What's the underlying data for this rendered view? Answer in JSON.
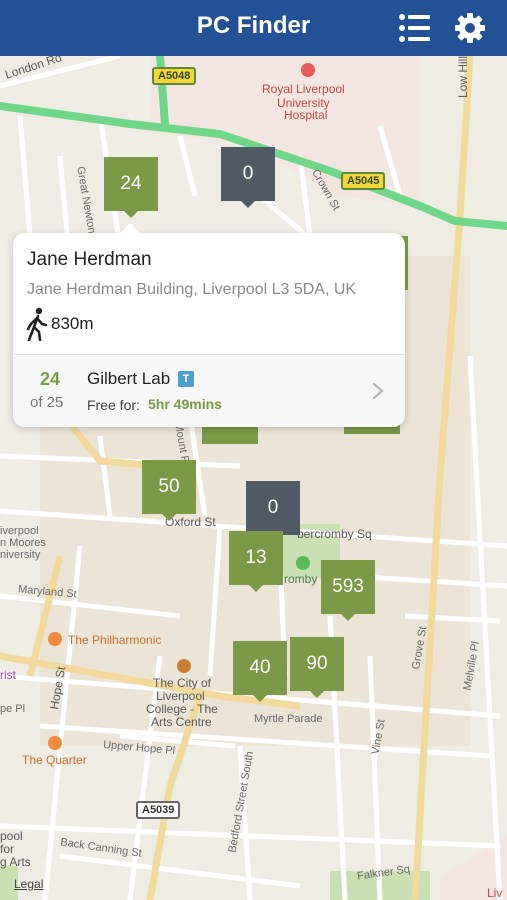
{
  "header": {
    "title": "PC Finder",
    "list_icon": "list-icon",
    "settings_icon": "gear-icon",
    "bg_color": "#235195"
  },
  "map": {
    "labels": {
      "london_rd": "London Rd",
      "a5048": "A5048",
      "hospital_1": "Royal Liverpool",
      "hospital_2": "University",
      "hospital_3": "Hospital",
      "low_hill": "Low Hill",
      "a5045": "A5045",
      "crown_st": "Crown St",
      "great_newton": "Great Newton",
      "mount_pl": "Mount Pl",
      "oxford_st": "Oxford St",
      "abercromby_sq": "bercromby Sq",
      "abercromby": "romby",
      "ljmu_1": "iverpool",
      "ljmu_2": "n Moores",
      "ljmu_3": "niversity",
      "maryland_st": "Maryland St",
      "philharmonic": "The Philharmonic",
      "hope_st": "Hope St",
      "grove_st": "Grove St",
      "melville_pl": "Melville Pl",
      "city_college_1": "The City of",
      "city_college_2": "Liverpool",
      "city_college_3": "College - The",
      "city_college_4": "Arts Centre",
      "myrtle_parade": "Myrtle Parade",
      "rist": "rist",
      "pe_pl": "pe Pl",
      "upper_hope_pl": "Upper Hope Pl",
      "the_quarter": "The Quarter",
      "vine_st": "Vine St",
      "a5039": "A5039",
      "bedford_st": "Bedford Street South",
      "lpool_1": "pool",
      "lpool_2": "for",
      "lpool_3": "g Arts",
      "back_canning": "Back Canning St",
      "faulkner_sq": "Falkner Sq",
      "legal": "Legal",
      "liv": "Liv"
    },
    "markers": [
      {
        "id": "m1",
        "label": "24",
        "status": "available"
      },
      {
        "id": "m2",
        "label": "0",
        "status": "full"
      },
      {
        "id": "m3",
        "label": "50",
        "status": "available"
      },
      {
        "id": "m4",
        "label": "0",
        "status": "full"
      },
      {
        "id": "m5",
        "label": "13",
        "status": "available"
      },
      {
        "id": "m6",
        "label": "593",
        "status": "available"
      },
      {
        "id": "m7",
        "label": "40",
        "status": "available"
      },
      {
        "id": "m8",
        "label": "90",
        "status": "available"
      }
    ],
    "colors": {
      "available": "#7a9a47",
      "full": "#4f5a66",
      "motorway": "#6fd68a",
      "major_road": "#f2d99c"
    }
  },
  "callout": {
    "name": "Jane Herdman",
    "address": "Jane Herdman Building, Liverpool L3 5DA, UK",
    "walk_icon": "walking-person-icon",
    "distance": "830m",
    "lab": {
      "available": "24",
      "total": "of 25",
      "name": "Gilbert Lab",
      "badge": "T",
      "free_label": "Free for:",
      "free_value": "5hr 49mins",
      "chevron_icon": "chevron-right-icon"
    }
  }
}
